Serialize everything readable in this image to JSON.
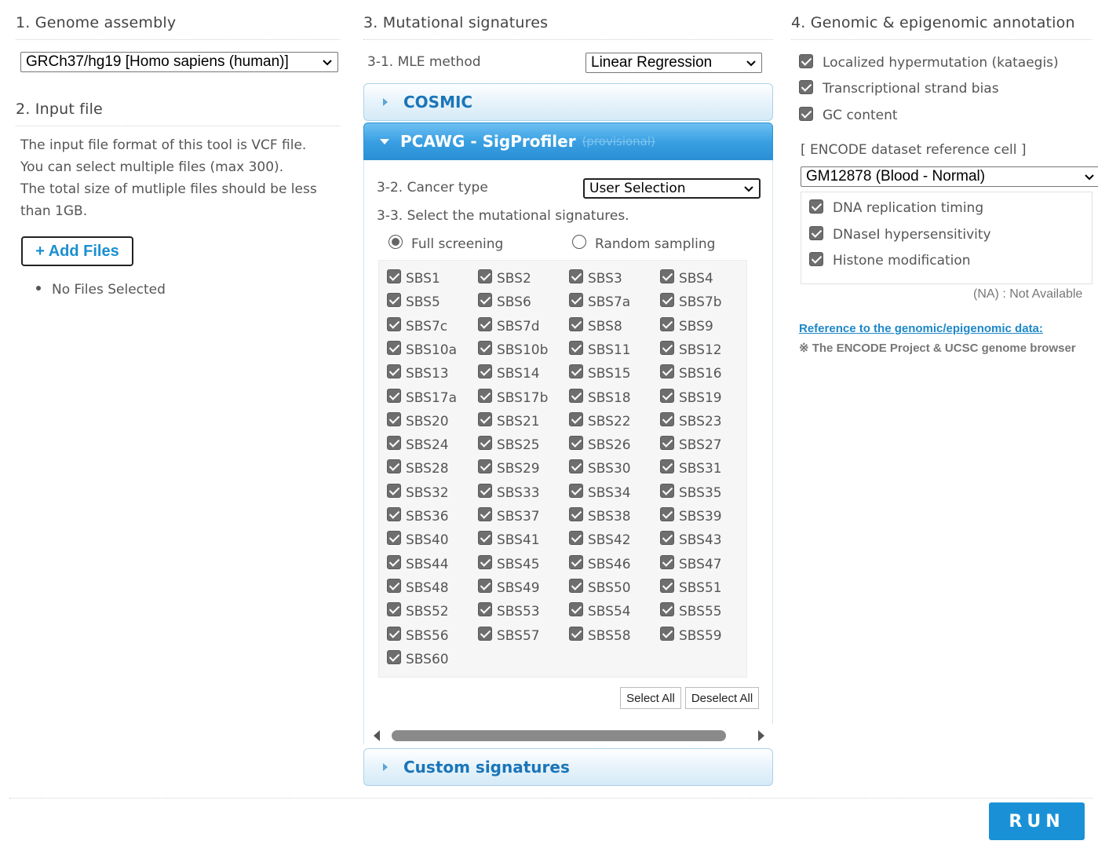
{
  "genome": {
    "title": "1. Genome assembly",
    "selected": "GRCh37/hg19 [Homo sapiens (human)]"
  },
  "input": {
    "title": "2. Input file",
    "desc": [
      "The input file format of this tool is VCF file.",
      "You can select multiple files (max 300).",
      "The total size of mutliple files should be less",
      "than 1GB."
    ],
    "add_label": "+ Add Files",
    "no_files": "No Files Selected"
  },
  "signatures": {
    "title": "3. Mutational signatures",
    "mle_label": "3-1. MLE method",
    "mle_value": "Linear Regression",
    "cosmic_label": "COSMIC",
    "pcawg_label": "PCAWG - SigProfiler",
    "pcawg_note": "(provisional)",
    "cancer_label": "3-2. Cancer type",
    "cancer_value": "User Selection",
    "select_label": "3-3. Select the mutational signatures.",
    "full_screening": "Full screening",
    "random_sampling": "Random sampling",
    "sbs": [
      "SBS1",
      "SBS2",
      "SBS3",
      "SBS4",
      "SBS5",
      "SBS6",
      "SBS7a",
      "SBS7b",
      "SBS7c",
      "SBS7d",
      "SBS8",
      "SBS9",
      "SBS10a",
      "SBS10b",
      "SBS11",
      "SBS12",
      "SBS13",
      "SBS14",
      "SBS15",
      "SBS16",
      "SBS17a",
      "SBS17b",
      "SBS18",
      "SBS19",
      "SBS20",
      "SBS21",
      "SBS22",
      "SBS23",
      "SBS24",
      "SBS25",
      "SBS26",
      "SBS27",
      "SBS28",
      "SBS29",
      "SBS30",
      "SBS31",
      "SBS32",
      "SBS33",
      "SBS34",
      "SBS35",
      "SBS36",
      "SBS37",
      "SBS38",
      "SBS39",
      "SBS40",
      "SBS41",
      "SBS42",
      "SBS43",
      "SBS44",
      "SBS45",
      "SBS46",
      "SBS47",
      "SBS48",
      "SBS49",
      "SBS50",
      "SBS51",
      "SBS52",
      "SBS53",
      "SBS54",
      "SBS55",
      "SBS56",
      "SBS57",
      "SBS58",
      "SBS59",
      "SBS60"
    ],
    "select_all": "Select All",
    "deselect_all": "Deselect All",
    "custom_label": "Custom signatures"
  },
  "annotation": {
    "title": "4. Genomic & epigenomic annotation",
    "kataegis": "Localized hypermutation (kataegis)",
    "strand_bias": "Transcriptional strand bias",
    "gc": "GC content",
    "encode_label": "[ ENCODE dataset reference cell ]",
    "encode_value": "GM12878 (Blood - Normal)",
    "replication": "DNA replication timing",
    "dnase": "DNaseI hypersensitivity",
    "histone": "Histone modification",
    "na_note": "(NA) : Not Available",
    "ref_link": "Reference to the genomic/epigenomic data:",
    "ref_note": "※ The ENCODE Project & UCSC genome browser"
  },
  "run_label": "RUN"
}
